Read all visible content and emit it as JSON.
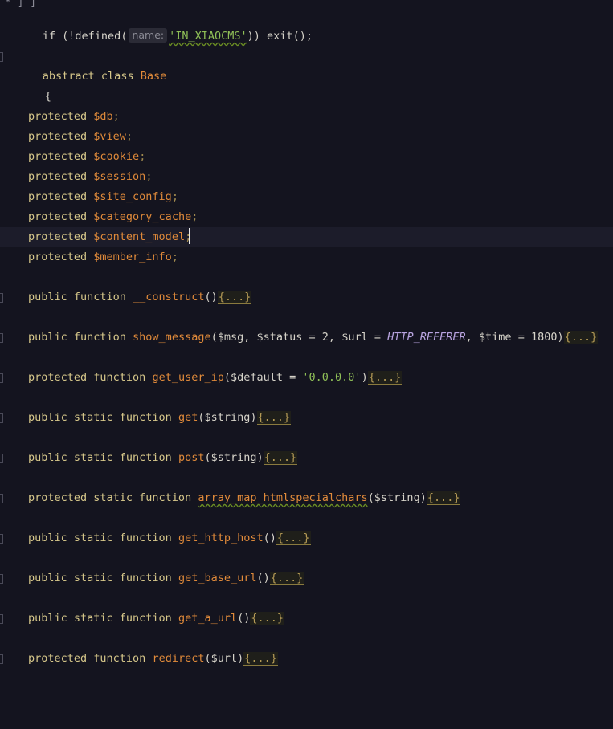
{
  "editor": {
    "top_fragment": "* ] ]",
    "line_guard": {
      "prefix": "if (!defined(",
      "hint": "name:",
      "string": "'IN_XIAOCMS'",
      "suffix": ")) exit();"
    },
    "class_decl": {
      "keyword": "abstract class ",
      "name": "Base"
    },
    "open_brace": "{",
    "properties": [
      {
        "modifier": "protected ",
        "name": "$db",
        "semi": ";"
      },
      {
        "modifier": "protected ",
        "name": "$view",
        "semi": ";"
      },
      {
        "modifier": "protected ",
        "name": "$cookie",
        "semi": ";"
      },
      {
        "modifier": "protected ",
        "name": "$session",
        "semi": ";"
      },
      {
        "modifier": "protected ",
        "name": "$site_config",
        "semi": ";"
      },
      {
        "modifier": "protected ",
        "name": "$category_cache",
        "semi": ";"
      },
      {
        "modifier": "protected ",
        "name": "$content_model",
        "semi": ";"
      },
      {
        "modifier": "protected ",
        "name": "$member_info",
        "semi": ";"
      }
    ],
    "fold_label": "{...}",
    "methods": {
      "construct": {
        "sig": "public function ",
        "name": "__construct",
        "args": "()"
      },
      "show_message": {
        "sig": "public function ",
        "name": "show_message",
        "open": "(",
        "p1": "$msg",
        "sep1": ", ",
        "p2": "$status",
        "eq2": " = 2, ",
        "p3": "$url",
        "eq3": " = ",
        "const3": "HTTP_REFERER",
        "sep3": ", ",
        "p4": "$time",
        "eq4": " = 1800)"
      },
      "get_user_ip": {
        "sig": "protected function ",
        "name": "get_user_ip",
        "open": "(",
        "p1": "$default",
        "eq": " = ",
        "str": "'0.0.0.0'",
        "close": ")"
      },
      "get": {
        "sig": "public static function ",
        "name": "get",
        "open": "(",
        "p1": "$string",
        "close": ")"
      },
      "post": {
        "sig": "public static function ",
        "name": "post",
        "open": "(",
        "p1": "$string",
        "close": ")"
      },
      "array_map": {
        "sig": "protected static function ",
        "name": "array_map_htmlspecialchars",
        "open": "(",
        "p1": "$string",
        "close": ")"
      },
      "get_http_host": {
        "sig": "public static function ",
        "name": "get_http_host",
        "args": "()"
      },
      "get_base_url": {
        "sig": "public static function ",
        "name": "get_base_url",
        "args": "()"
      },
      "get_a_url": {
        "sig": "public static function ",
        "name": "get_a_url",
        "args": "()"
      },
      "redirect": {
        "sig": "protected function ",
        "name": "redirect",
        "open": "(",
        "p1": "$url",
        "close": ")"
      }
    }
  }
}
